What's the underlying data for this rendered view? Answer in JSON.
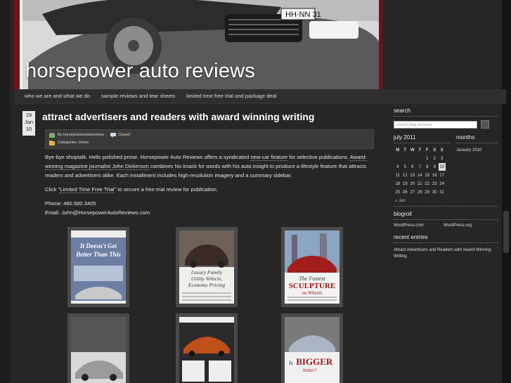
{
  "site": {
    "title": "horsepower auto reviews"
  },
  "nav": {
    "items": [
      "who we are and what we do",
      "sample reviews and tear sheets",
      "limited time free trial and package deal"
    ]
  },
  "post": {
    "date": {
      "day": "19",
      "month": "Jan",
      "year": "10"
    },
    "title": "attract advertisers and readers with award winning writing",
    "meta": {
      "author": "By horsepowerautoreviews",
      "comments": "Closed",
      "categories": "Categories: Home"
    },
    "p1": {
      "a": "Bye-bye shoptalk. Hello polished prose. Horsepower Auto Reviews offers a syndicated ",
      "link1": "new-car feature",
      "b": " for selective publications. ",
      "link2": "Award-winning magazine journalist John Dickerson",
      "c": " combines his knack for words with his auto insight to produce a lifestyle feature that attracts readers and advertisers alike. Each installment includes high-resolution imagery and a summary sidebar."
    },
    "p2": {
      "a": "Click \"",
      "link": "Limited Time Free Trial",
      "b": "\" to secure a free trial review for publication."
    },
    "phone": "Phone: 480.580.3405",
    "email": "Email: John@HorsepowerAutoReviews.com",
    "thumbs": [
      {
        "headline1": "It Doesn't Get",
        "headline2": "Better Than This"
      },
      {
        "headline1": "Luxury Family",
        "headline2": "Utility Vehicle,",
        "headline3": "Economy Pricing"
      },
      {
        "headline1": "The Fastest",
        "headline2": "SCULPTURE",
        "headline3": "on Wheels"
      },
      {
        "headline1": ""
      },
      {
        "headline1": ""
      },
      {
        "headline1": "Is",
        "headline2": "BIGGER",
        "headline3": "better?"
      }
    ]
  },
  "sidebar": {
    "search_title": "search",
    "search_placeholder": "search blog archives",
    "calendar_title": "july 2011",
    "calendar_days": [
      "M",
      "T",
      "W",
      "T",
      "F",
      "S",
      "S"
    ],
    "calendar_rows": [
      [
        "",
        "",
        "",
        "",
        "1",
        "2",
        "3"
      ],
      [
        "4",
        "5",
        "6",
        "7",
        "8",
        "9",
        "10"
      ],
      [
        "11",
        "12",
        "13",
        "14",
        "15",
        "16",
        "17"
      ],
      [
        "18",
        "19",
        "20",
        "21",
        "22",
        "23",
        "24"
      ],
      [
        "25",
        "26",
        "27",
        "28",
        "29",
        "30",
        "31"
      ]
    ],
    "calendar_prev": "« Jan",
    "months_title": "months",
    "months_item": "January 2010",
    "blogroll_title": "blogroll",
    "blogroll_items": [
      "WordPress.com",
      "WordPress.org"
    ],
    "recent_title": "recent entries",
    "recent_item": "Attract Advertisers and Readers with Award Winning Writing"
  }
}
